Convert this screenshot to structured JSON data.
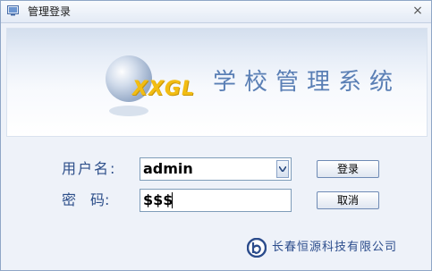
{
  "window": {
    "title": "管理登录",
    "close_glyph": "×"
  },
  "banner": {
    "logo_text": "XXGL",
    "system_name": "学校管理系统"
  },
  "form": {
    "username_label": "用户名:",
    "password_label": "密　码:",
    "username_value": "admin",
    "password_value": "$$$"
  },
  "buttons": {
    "login": "登录",
    "cancel": "取消"
  },
  "footer": {
    "company": "长春恒源科技有限公司"
  },
  "colors": {
    "label": "#2d4f8a",
    "logo_yellow": "#f2bd13",
    "system_blue": "#5a7fb5"
  },
  "icons": [
    "app-icon",
    "close-icon",
    "dropdown-arrow-icon",
    "company-logo-icon"
  ]
}
